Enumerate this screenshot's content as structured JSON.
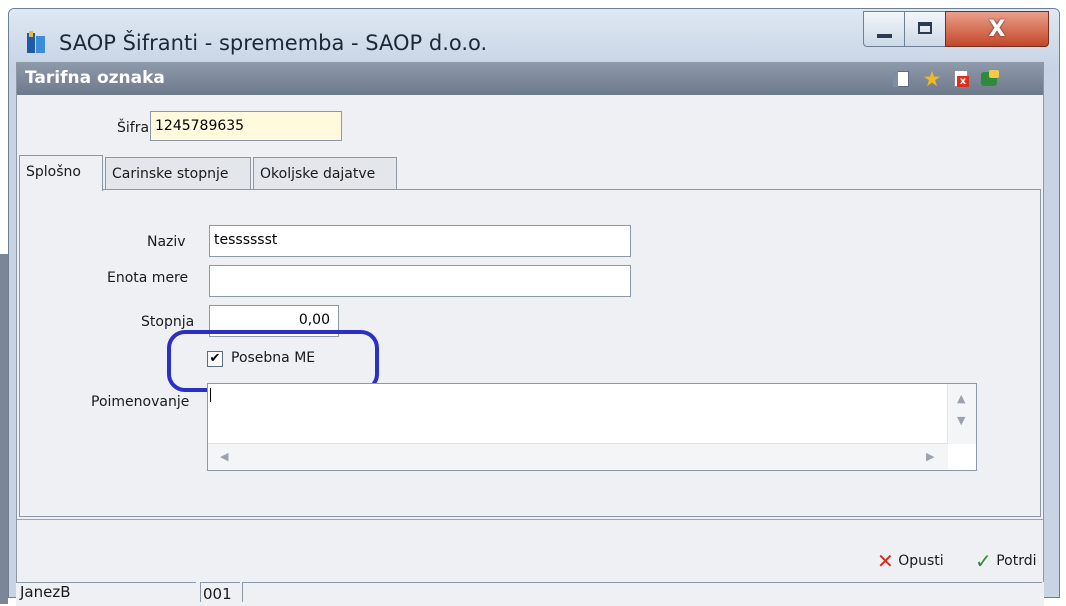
{
  "window": {
    "title": "SAOP Šifranti - sprememba - SAOP d.o.o.",
    "close_glyph": "X"
  },
  "header": {
    "title": "Tarifna oznaka",
    "icons": [
      "grid-icon",
      "star-icon",
      "delete-document-icon",
      "exit-icon"
    ]
  },
  "form": {
    "sifra_label": "Šifra",
    "sifra_value": "1245789635"
  },
  "tabs": [
    {
      "label": "Splošno",
      "active": true
    },
    {
      "label": "Carinske stopnje",
      "active": false
    },
    {
      "label": "Okoljske dajatve",
      "active": false
    }
  ],
  "general": {
    "naziv_label": "Naziv",
    "naziv_value": "tesssssst",
    "enota_label": "Enota mere",
    "enota_value": "",
    "stopnja_label": "Stopnja",
    "stopnja_value": "0,00",
    "posebna_label": "Posebna ME",
    "posebna_checked": true,
    "poimenovanje_label": "Poimenovanje",
    "poimenovanje_value": ""
  },
  "footer": {
    "cancel_label": "Opusti",
    "confirm_label": "Potrdi"
  },
  "status": {
    "user": "JanezB",
    "code": "001"
  },
  "colors": {
    "header_bar": "#7f8b9b",
    "code_field": "#fffadd",
    "highlight": "#2c2fc7",
    "cancel": "#d22b1f",
    "confirm": "#2d8f2a"
  }
}
